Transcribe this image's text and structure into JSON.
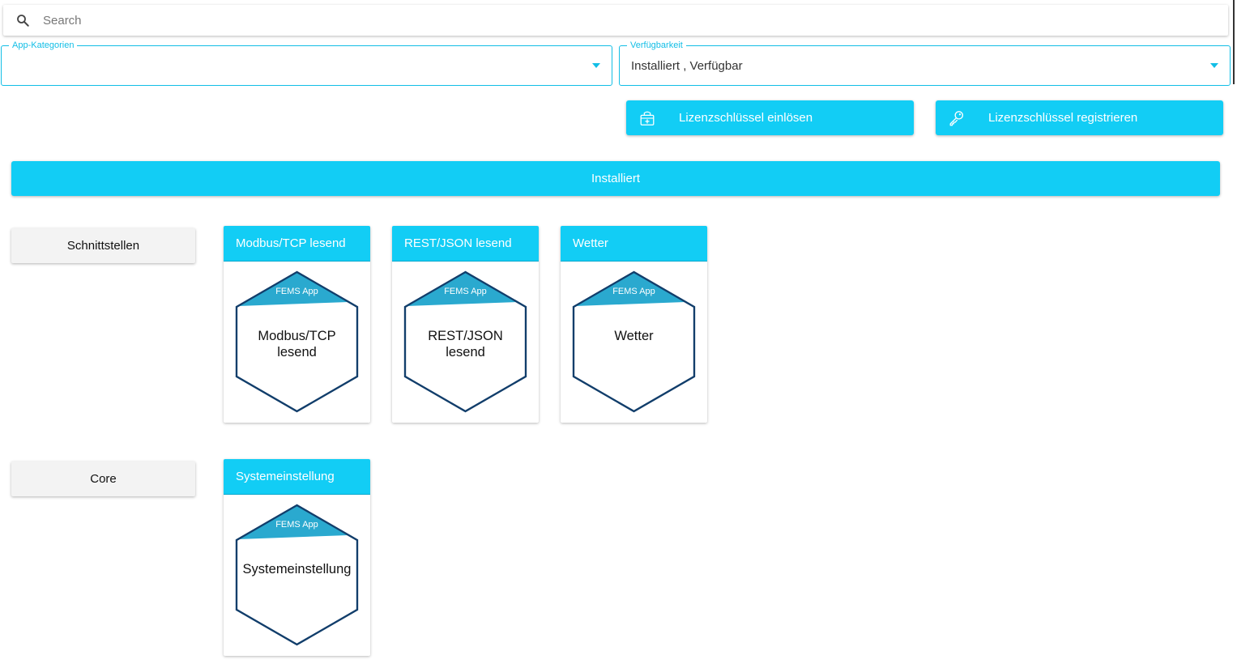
{
  "search": {
    "placeholder": "Search",
    "icon": "search-icon"
  },
  "filters": {
    "categories": {
      "label": "App-Kategorien",
      "value": ""
    },
    "availability": {
      "label": "Verfügbarkeit",
      "value": "Installiert , Verfügbar"
    }
  },
  "actions": {
    "redeem_label": "Lizenzschlüssel einlösen",
    "register_label": "Lizenzschlüssel registrieren"
  },
  "section": {
    "title": "Installiert"
  },
  "categories": [
    {
      "name": "Schnittstellen",
      "apps": [
        {
          "title": "Modbus/TCP lesend",
          "badge": "FEMS App",
          "icon_text": [
            "Modbus/TCP",
            "lesend"
          ]
        },
        {
          "title": "REST/JSON lesend",
          "badge": "FEMS App",
          "icon_text": [
            "REST/JSON",
            "lesend"
          ]
        },
        {
          "title": "Wetter",
          "badge": "FEMS App",
          "icon_text": [
            "Wetter"
          ]
        }
      ]
    },
    {
      "name": "Core",
      "apps": [
        {
          "title": "Systemeinstellung",
          "badge": "FEMS App",
          "icon_text": [
            "Systemeinstellung"
          ]
        }
      ]
    }
  ],
  "colors": {
    "accent": "#12cdf5",
    "field_border": "#12bee6",
    "hex_stroke": "#123e6b",
    "badge_fill": "#2aa9cf"
  }
}
